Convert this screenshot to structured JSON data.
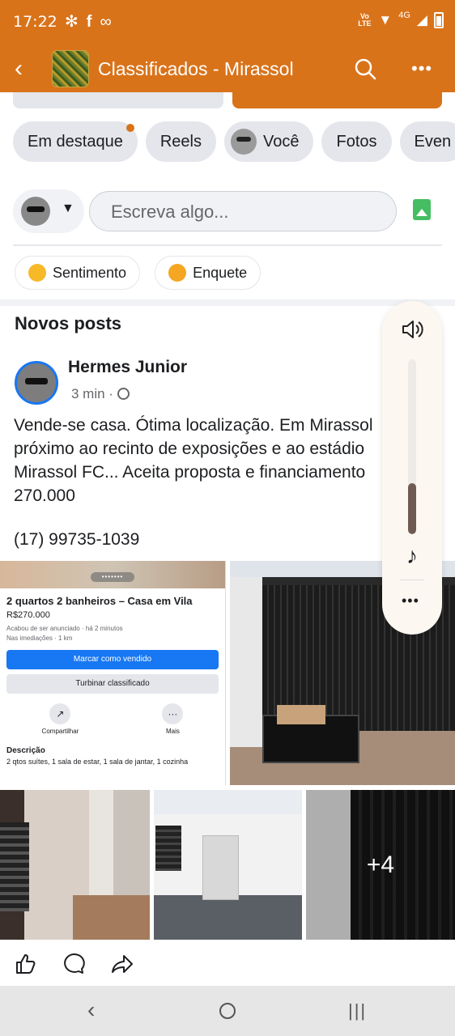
{
  "status_bar": {
    "time": "17:22",
    "left_icons": [
      "pinwheel-icon",
      "facebook-icon",
      "infinity-icon"
    ],
    "net_label": "Vo LTE",
    "net_type": "4G"
  },
  "app_bar": {
    "title": "Classificados - Mirassol",
    "accent": "#d9731a"
  },
  "chips": [
    {
      "label": "Em destaque",
      "has_dot": true
    },
    {
      "label": "Reels"
    },
    {
      "label": "Você",
      "has_avatar": true
    },
    {
      "label": "Fotos"
    },
    {
      "label": "Even"
    }
  ],
  "composer": {
    "placeholder": "Escreva algo..."
  },
  "quick_actions": [
    {
      "label": "Sentimento"
    },
    {
      "label": "Enquete"
    }
  ],
  "section": {
    "title": "Novos posts"
  },
  "post": {
    "author": "Hermes Junior",
    "time": "3 min ·",
    "text": "Vende-se casa. Ótima localização. Em Mirassol próximo ao recinto de exposições e ao estádio Mirassol FC... Aceita proposta e financiamento 270.000",
    "phone": "(17) 99735-1039",
    "more_photos": "+4",
    "listing": {
      "title": "2 quartos 2 banheiros – Casa em Vila",
      "price": "R$270.000",
      "listed": "Acabou de ser anunciado · há 2 minutos",
      "distance": "Nas imediações · 1 km",
      "primary_btn": "Marcar como vendido",
      "secondary_btn": "Turbinar classificado",
      "share": "Compartilhar",
      "more": "Mais",
      "desc_title": "Descrição",
      "desc": "2 qtos suítes, 1 sala de estar, 1 sala de jantar, 1 cozinha"
    }
  },
  "volume": {
    "level": 0.29
  }
}
